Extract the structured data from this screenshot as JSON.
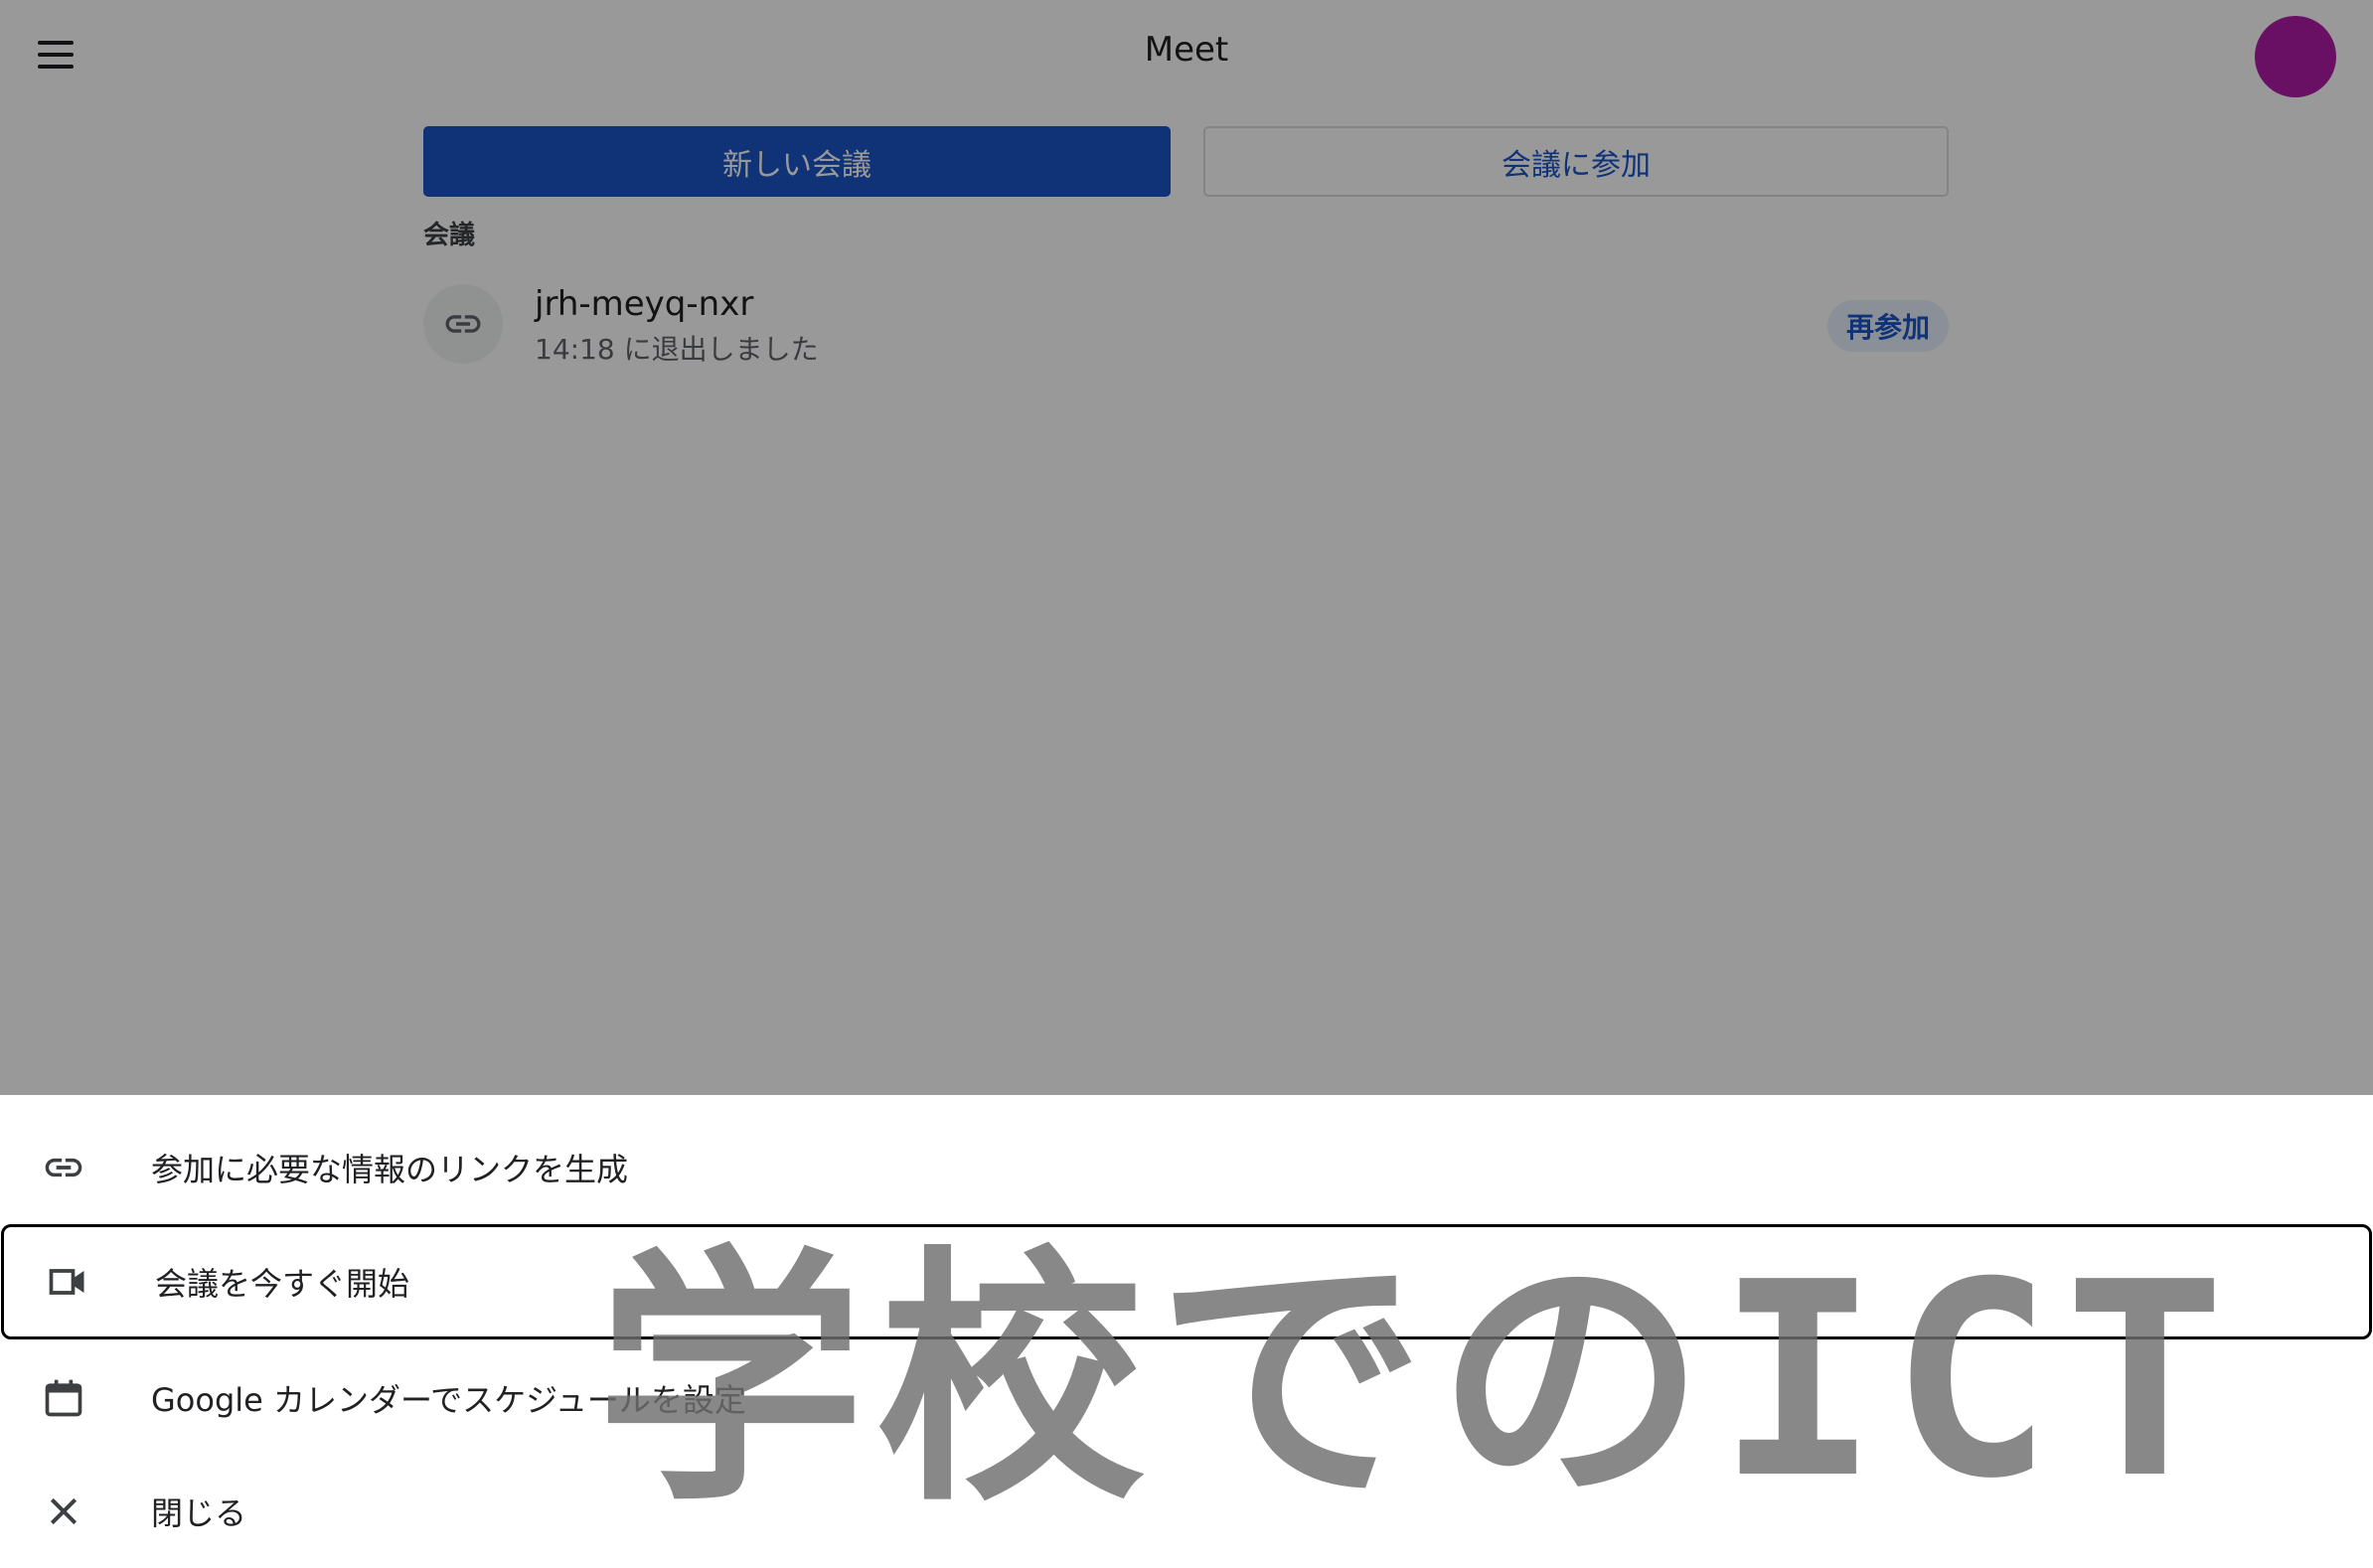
{
  "header": {
    "title": "Meet",
    "menu_icon": "menu-icon",
    "avatar_color": "#b01aa7"
  },
  "actions": {
    "new_meeting_label": "新しい会議",
    "join_meeting_label": "会議に参加"
  },
  "section": {
    "label": "会議"
  },
  "meetings": [
    {
      "code": "jrh-meyq-nxr",
      "status": "14:18 に退出しました",
      "icon": "link-icon",
      "rejoin_label": "再参加"
    }
  ],
  "sheet": {
    "items": [
      {
        "label": "参加に必要な情報のリンクを生成",
        "icon": "link-icon"
      },
      {
        "label": "会議を今すぐ開始",
        "icon": "video-camera-icon"
      },
      {
        "label": "Google カレンダーでスケジュールを設定",
        "icon": "calendar-icon"
      },
      {
        "label": "閉じる",
        "icon": "close-icon"
      }
    ]
  },
  "watermark": {
    "text": "学校でのICT"
  },
  "colors": {
    "primary": "#1a56c5",
    "scrim": "rgba(0,0,0,0.40)",
    "text": "#202124",
    "secondary_text": "#5f6368"
  }
}
